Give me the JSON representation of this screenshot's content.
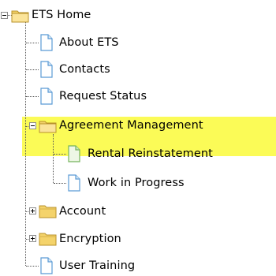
{
  "tree": {
    "root": {
      "label": "ETS Home",
      "icon": "folder-open-icon",
      "state": "expanded"
    },
    "items": [
      {
        "label": "About ETS",
        "icon": "page-icon"
      },
      {
        "label": "Contacts",
        "icon": "page-icon"
      },
      {
        "label": "Request Status",
        "icon": "page-icon"
      },
      {
        "label": "Agreement Management",
        "icon": "folder-open-icon",
        "state": "expanded",
        "children": [
          {
            "label": "Rental Reinstatement",
            "icon": "page-green-icon",
            "selected": true
          },
          {
            "label": "Work in Progress",
            "icon": "page-icon"
          }
        ]
      },
      {
        "label": "Account",
        "icon": "folder-icon",
        "state": "collapsed"
      },
      {
        "label": "Encryption",
        "icon": "folder-icon",
        "state": "collapsed"
      },
      {
        "label": "User Training",
        "icon": "page-icon"
      }
    ]
  },
  "colors": {
    "highlight": "#fbfb57",
    "folder": "#f4d36b",
    "page_blue": "#5b9bd5",
    "page_green": "#74b35c"
  }
}
